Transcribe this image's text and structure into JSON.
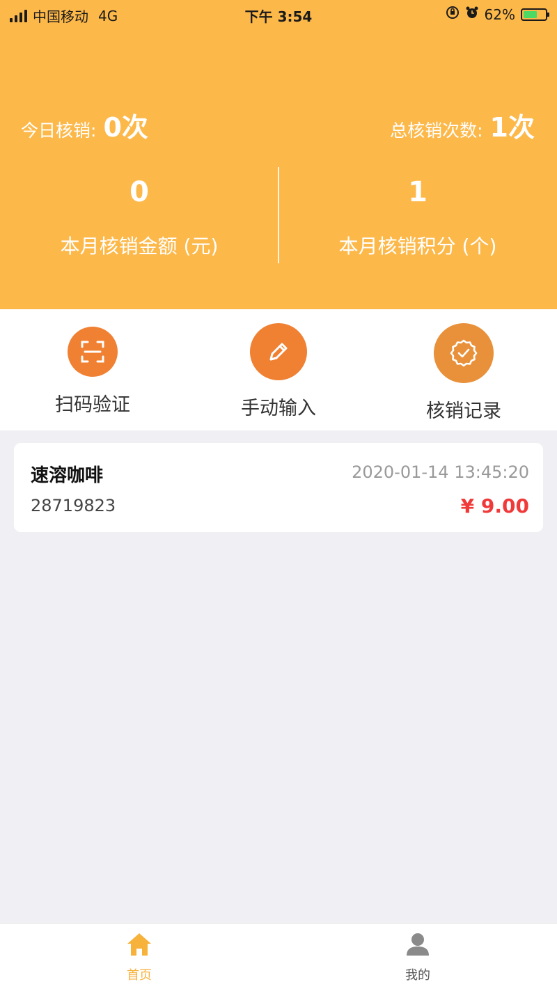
{
  "status_bar": {
    "carrier": "中国移动",
    "network": "4G",
    "time": "下午 3:54",
    "battery": "62%",
    "battery_level": 0.62
  },
  "header": {
    "today_label": "今日核销:",
    "today_value": "0次",
    "total_label": "总核销次数:",
    "total_value": "1次",
    "month_amount_value": "0",
    "month_amount_label": "本月核销金额 (元)",
    "month_points_value": "1",
    "month_points_label": "本月核销积分 (个)"
  },
  "actions": [
    {
      "label": "扫码验证",
      "icon": "scan-icon",
      "color": "#f08032"
    },
    {
      "label": "手动输入",
      "icon": "pencil-icon",
      "color": "#f08032"
    },
    {
      "label": "核销记录",
      "icon": "verified-badge-icon",
      "color": "#e8913a"
    }
  ],
  "records": [
    {
      "name": "速溶咖啡",
      "time": "2020-01-14 13:45:20",
      "code": "28719823",
      "price": "¥ 9.00"
    }
  ],
  "tabbar": {
    "home_label": "首页",
    "mine_label": "我的",
    "active_color": "#f7b23b"
  },
  "colors": {
    "header_bg": "#fdb84a",
    "page_bg": "#f0f0f4",
    "price": "#f03a3a"
  }
}
